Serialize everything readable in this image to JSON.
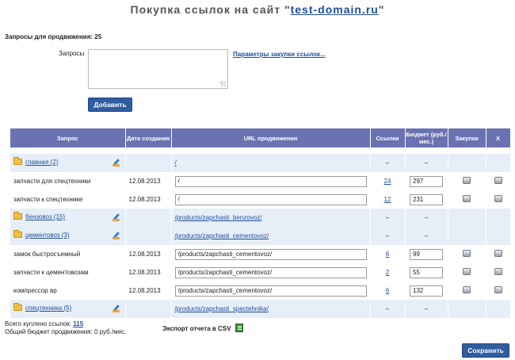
{
  "header": {
    "title_prefix": "Покупка ссылок на сайт \"",
    "domain": "test-domain.ru",
    "title_suffix": "\""
  },
  "queries_count_label": "Запросы для продвижения: 25",
  "form": {
    "label": "Запросы",
    "params_link": "Параметры закупки ссылок...",
    "add_button": "Добавить"
  },
  "table": {
    "headers": {
      "query": "Запрос",
      "date": "Дата создания",
      "url": "URL продвижения",
      "links": "Ссылки",
      "budget": "Бюджет (руб./мес.)",
      "purchase": "Закупка",
      "x": "X"
    },
    "rows": [
      {
        "type": "group",
        "name": "главная (2)",
        "url": "/",
        "links": "–",
        "budget": "–"
      },
      {
        "type": "item",
        "name": "запчасти для спецтехники",
        "date": "12.08.2013",
        "url": "/",
        "links": "24",
        "budget": "297"
      },
      {
        "type": "item",
        "name": "запчасти к спецтехнике",
        "date": "12.08.2013",
        "url": "/",
        "links": "12",
        "budget": "231"
      },
      {
        "type": "group",
        "name": "бензовоз (15)",
        "url": "/products/zapchasti_benzovoz/",
        "links": "–",
        "budget": "–"
      },
      {
        "type": "group",
        "name": "цементовоз (3)",
        "url": "/products/zapchasti_cementovoz/",
        "links": "–",
        "budget": "–"
      },
      {
        "type": "item",
        "name": "замок быстросъемный",
        "date": "12.08.2013",
        "url": "/products/zapchasti_cementovoz/",
        "links": "6",
        "budget": "99"
      },
      {
        "type": "item",
        "name": "запчасти к цементовозам",
        "date": "12.08.2013",
        "url": "/products/zapchasti_cementovoz/",
        "links": "2",
        "budget": "55"
      },
      {
        "type": "item",
        "name": "компрессор вр",
        "date": "12.08.2013",
        "url": "/products/zapchasti_cementovoz/",
        "links": "6",
        "budget": "132"
      },
      {
        "type": "group",
        "name": "спецтехника (5)",
        "url": "/products/zapchasti_spectehnika/",
        "links": "–",
        "budget": "–"
      }
    ]
  },
  "footer": {
    "total_prefix": "Всего куплено ссылок: ",
    "total_links": "115",
    "budget_text": "Общий бюджет продвижения: 0 руб./мес.",
    "export_label": "Экспорт отчета в CSV",
    "save_button": "Сохранить"
  }
}
